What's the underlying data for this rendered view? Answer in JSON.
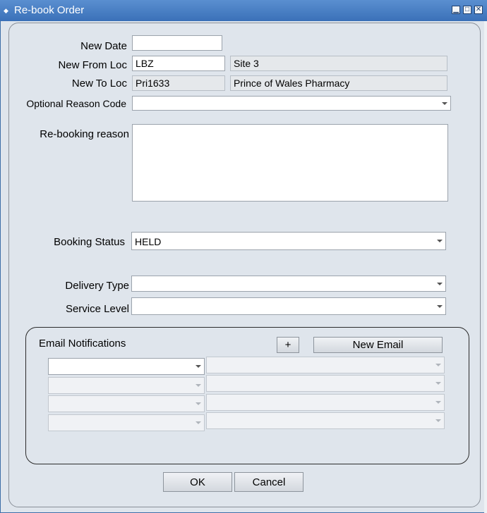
{
  "window": {
    "title": "Re-book Order",
    "controls": [
      "minimize-icon",
      "maximize-icon",
      "close-icon"
    ]
  },
  "form": {
    "new_date": {
      "label": "New Date",
      "value": ""
    },
    "new_from_loc": {
      "label": "New From Loc",
      "code": "LBZ",
      "description": "Site 3"
    },
    "new_to_loc": {
      "label": "New To Loc",
      "code": "Pri1633",
      "description": "Prince of Wales Pharmacy"
    },
    "optional_reason_code": {
      "label": "Optional Reason Code",
      "value": ""
    },
    "rebooking_reason": {
      "label": "Re-booking reason",
      "value": ""
    },
    "booking_status": {
      "label": "Booking Status",
      "value": "HELD"
    },
    "delivery_type": {
      "label": "Delivery Type",
      "value": ""
    },
    "service_level": {
      "label": "Service Level",
      "value": ""
    }
  },
  "email": {
    "title": "Email Notifications",
    "add_label": "+",
    "new_email_label": "New Email",
    "rows": [
      {
        "type": "",
        "address": ""
      },
      {
        "type": "",
        "address": ""
      },
      {
        "type": "",
        "address": ""
      },
      {
        "type": "",
        "address": ""
      }
    ]
  },
  "buttons": {
    "ok": "OK",
    "cancel": "Cancel"
  }
}
